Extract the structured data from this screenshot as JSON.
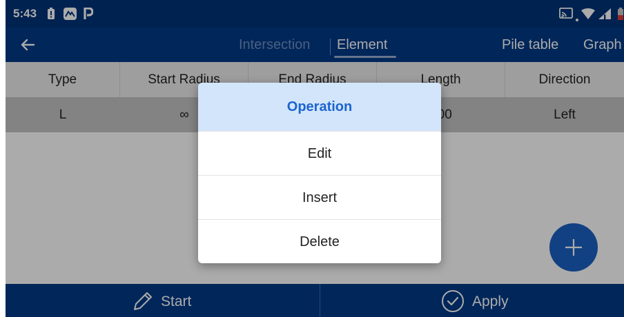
{
  "status_bar": {
    "time": "5:43",
    "left_icons": [
      "battery-alert-icon",
      "app-logo-icon",
      "parking-icon"
    ],
    "right_icons": [
      "cast-icon",
      "wifi-icon",
      "signal-icon",
      "battery-icon"
    ]
  },
  "app_bar": {
    "back_icon": "arrow-left-icon",
    "tabs": [
      {
        "label": "Intersection",
        "active": false
      },
      {
        "label": "Element",
        "active": true
      }
    ],
    "actions": [
      "Pile table",
      "Graph"
    ]
  },
  "table": {
    "columns": [
      "Type",
      "Start Radius",
      "End Radius",
      "Length",
      "Direction"
    ],
    "rows": [
      {
        "type": "L",
        "start_radius": "∞",
        "length": "000",
        "direction": "Left"
      }
    ]
  },
  "fab": {
    "icon": "plus-icon"
  },
  "bottom_bar": {
    "start": {
      "icon": "pencil-icon",
      "label": "Start"
    },
    "apply": {
      "icon": "check-circle-icon",
      "label": "Apply"
    }
  },
  "dialog": {
    "title": "Operation",
    "items": [
      "Edit",
      "Insert",
      "Delete"
    ]
  },
  "colors": {
    "primary": "#003a86",
    "status_bar": "#00347a",
    "fab": "#1a62c2",
    "dialog_title_bg": "#d2e5fb",
    "dialog_title_text": "#1c64d0"
  }
}
